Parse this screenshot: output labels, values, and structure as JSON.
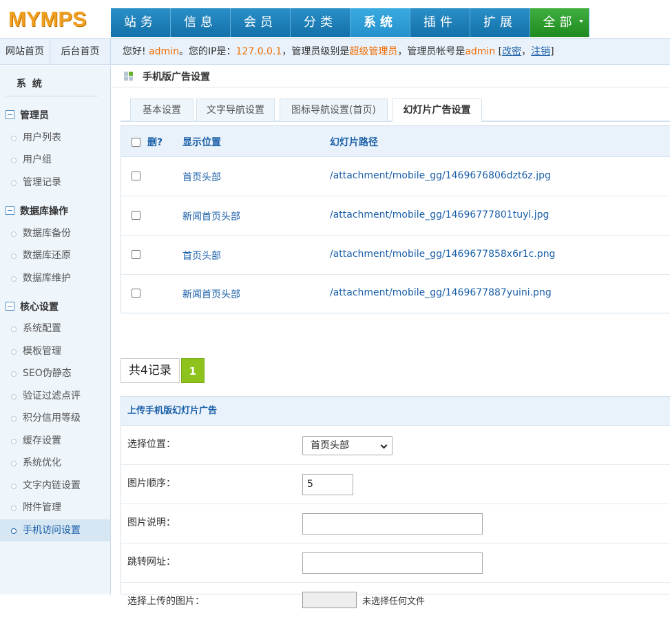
{
  "header": {
    "logo": "MYMPS",
    "nav": [
      "站务",
      "信息",
      "会员",
      "分类",
      "系统",
      "插件",
      "扩展",
      "全部"
    ],
    "active_nav": "系统"
  },
  "subbar": {
    "site_home": "网站首页",
    "admin_home": "后台首页",
    "greeting": "您好!",
    "username": "admin",
    "ip_label": "。您的IP是：",
    "ip": "127.0.0.1",
    "level_label": "，管理员级别是",
    "level": "超级管理员",
    "account_label": "，管理员帐号是",
    "account": "admin",
    "open_bracket": " [",
    "change_password": "改密",
    "sep": "，",
    "logout": "注销",
    "close_bracket": "]"
  },
  "sidebar": {
    "title": "系 统",
    "groups": [
      {
        "label": "管理员",
        "items": [
          "用户列表",
          "用户组",
          "管理记录"
        ]
      },
      {
        "label": "数据库操作",
        "items": [
          "数据库备份",
          "数据库还原",
          "数据库维护"
        ]
      },
      {
        "label": "核心设置",
        "items": [
          "系统配置",
          "模板管理",
          "SEO伪静态",
          "验证过滤点评",
          "积分信用等级",
          "缓存设置",
          "系统优化",
          "文字内链设置",
          "附件管理",
          "手机访问设置"
        ]
      }
    ],
    "active_item": "手机访问设置"
  },
  "main": {
    "title": "手机版广告设置",
    "tabs": [
      "基本设置",
      "文字导航设置",
      "图标导航设置(首页)",
      "幻灯片广告设置"
    ],
    "active_tab": "幻灯片广告设置",
    "table": {
      "headers": {
        "delete": "删?",
        "position": "显示位置",
        "path": "幻灯片路径"
      },
      "rows": [
        {
          "position": "首页头部",
          "path": "/attachment/mobile_gg/1469676806dzt6z.jpg"
        },
        {
          "position": "新闻首页头部",
          "path": "/attachment/mobile_gg/14696777801tuyl.jpg"
        },
        {
          "position": "首页头部",
          "path": "/attachment/mobile_gg/1469677858x6r1c.png"
        },
        {
          "position": "新闻首页头部",
          "path": "/attachment/mobile_gg/1469677887yuini.png"
        }
      ]
    },
    "pager": {
      "total": "共4记录",
      "current": "1"
    },
    "upload": {
      "title": "上传手机版幻灯片广告",
      "fields": {
        "position_label": "选择位置：",
        "position_value": "首页头部",
        "order_label": "图片顺序：",
        "order_value": "5",
        "desc_label": "图片说明：",
        "desc_value": "",
        "url_label": "跳转网址：",
        "url_value": "",
        "file_label": "选择上传的图片：",
        "file_hint": "未选择任何文件"
      }
    }
  }
}
